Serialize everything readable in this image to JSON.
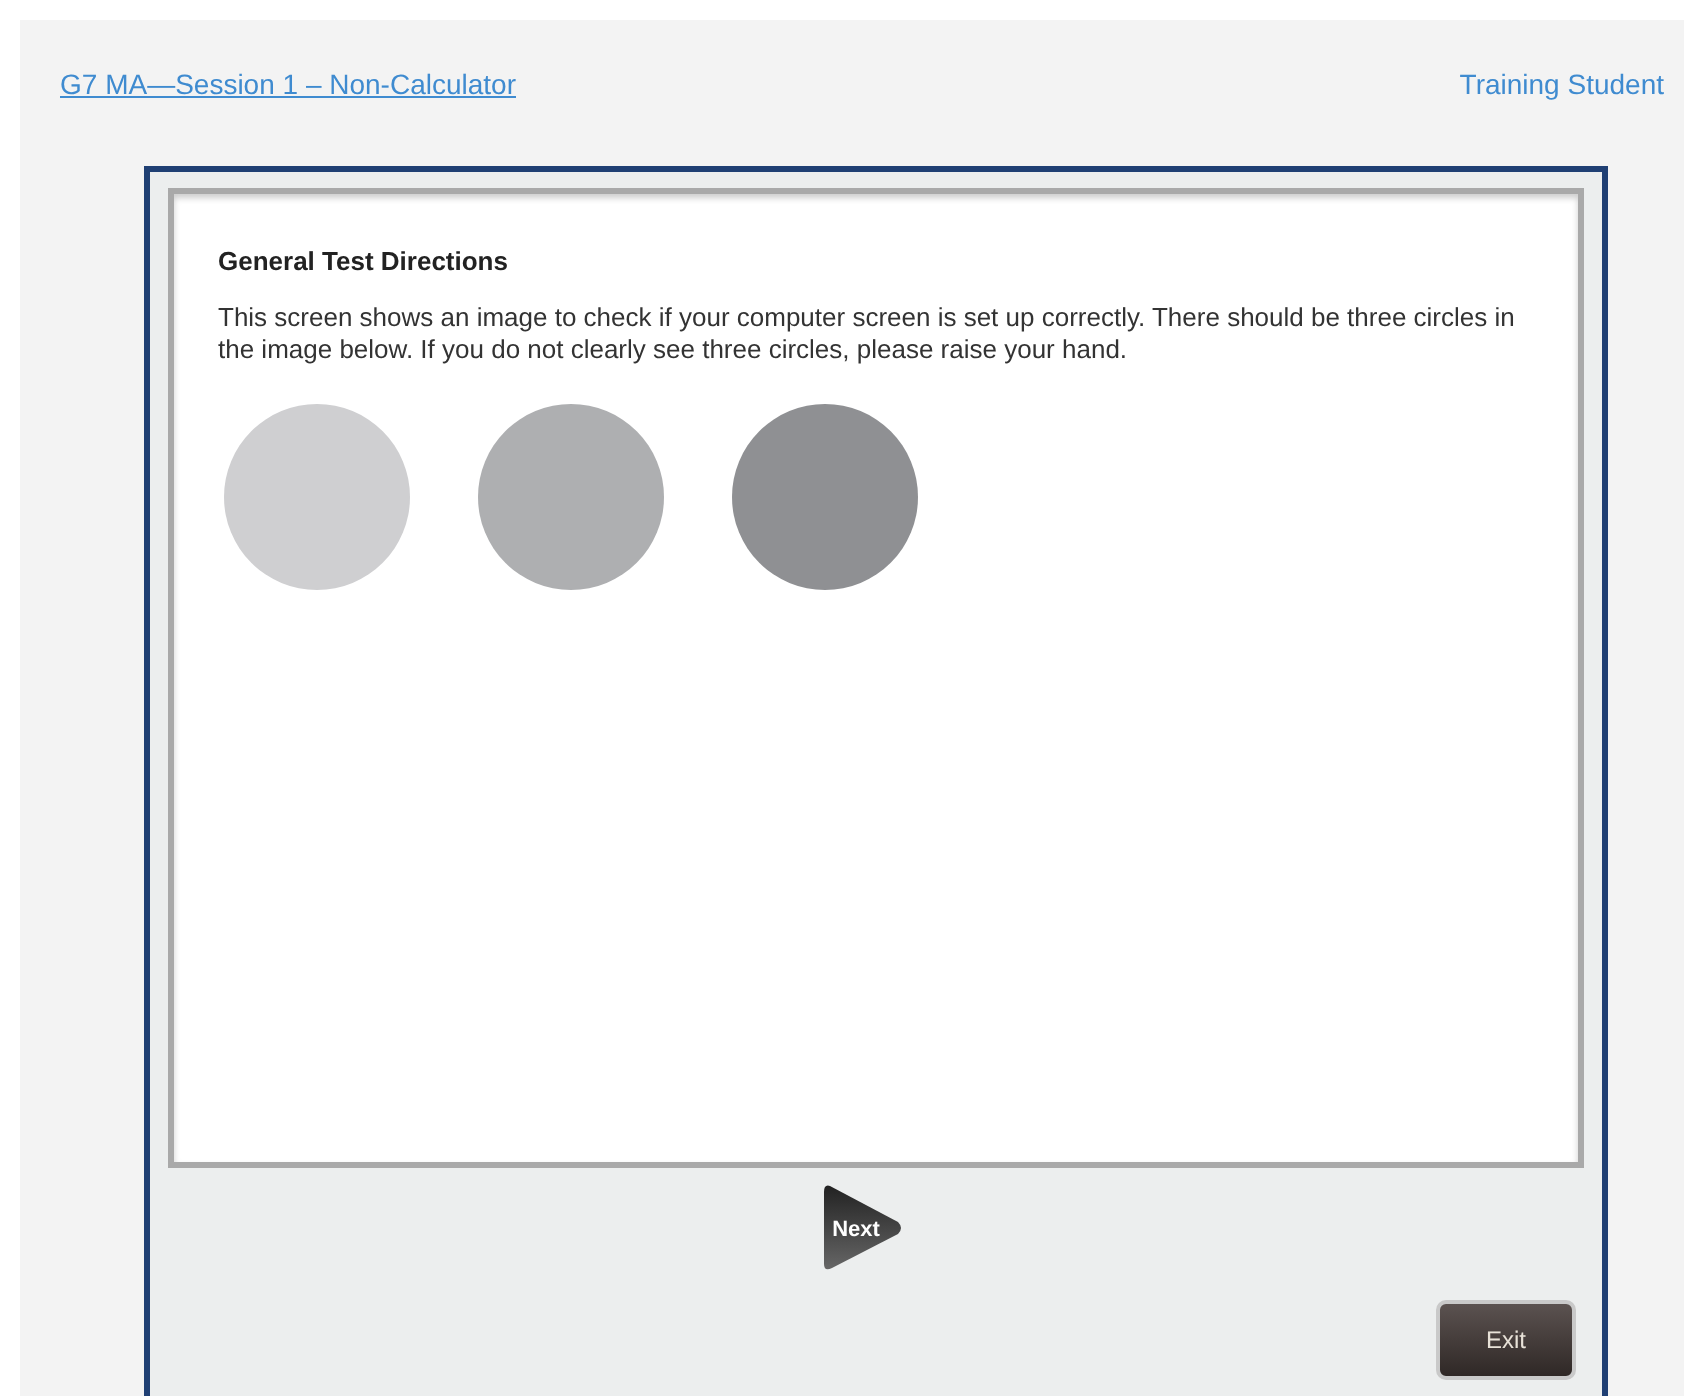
{
  "header": {
    "test_link": "G7 MA—Session 1 – Non-Calculator",
    "user_name": "Training Student"
  },
  "content": {
    "heading": "General Test Directions",
    "paragraph": "This screen shows an image to check if your computer screen is set up correctly. There should be three circles in the image below. If you do not clearly see three circles, please raise your hand.",
    "circles": [
      {
        "color": "#cfcfd1"
      },
      {
        "color": "#aeafb1"
      },
      {
        "color": "#8f9093"
      }
    ]
  },
  "buttons": {
    "next": "Next",
    "exit": "Exit"
  }
}
